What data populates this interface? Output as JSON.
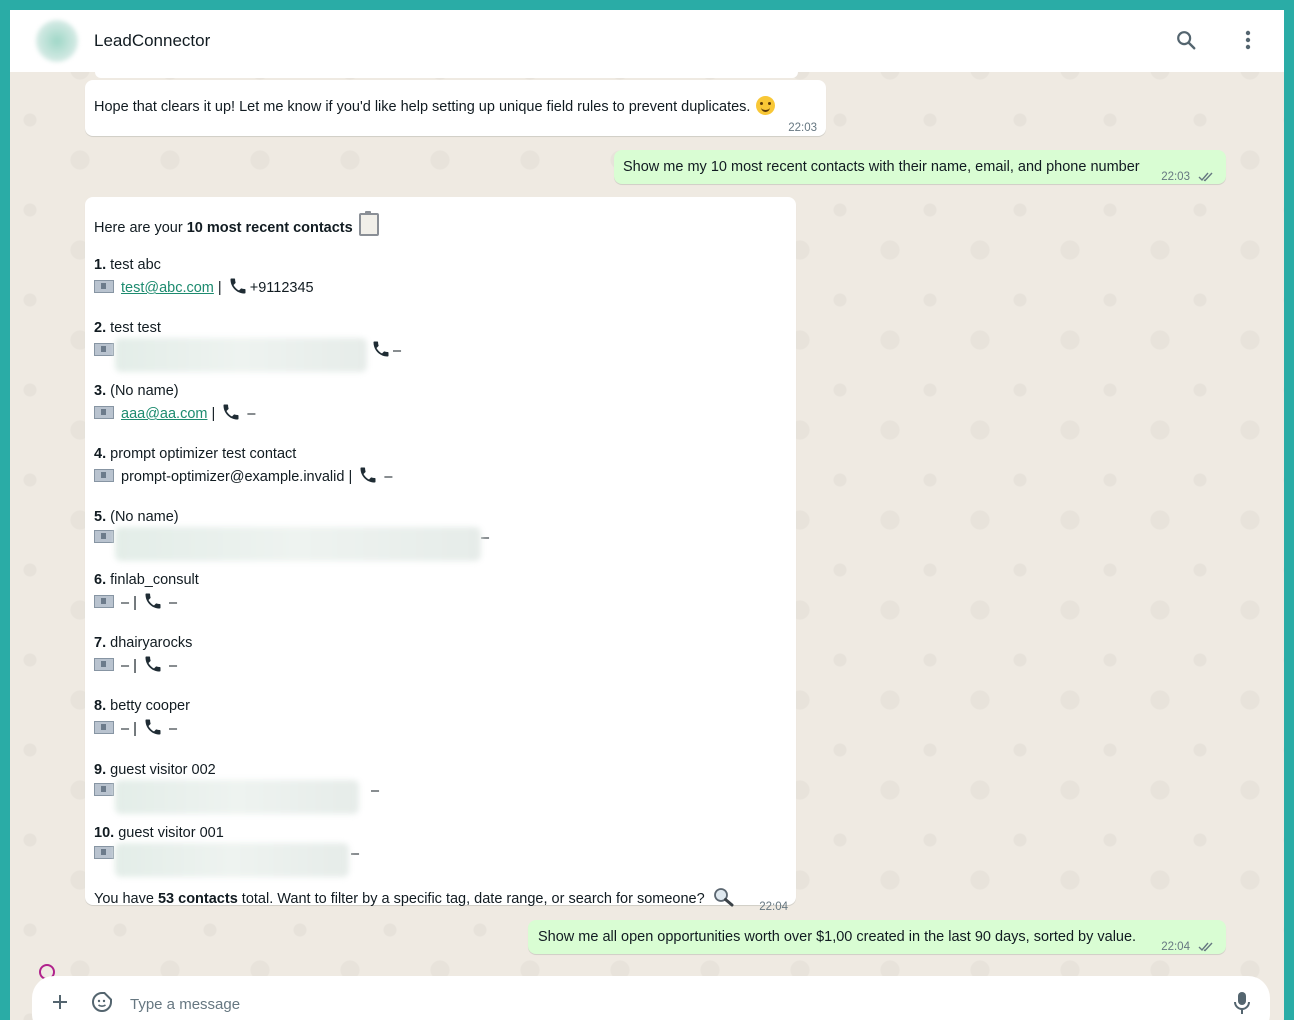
{
  "header": {
    "title": "LeadConnector",
    "icons": [
      "search-icon",
      "more-vert-icon"
    ]
  },
  "messages": {
    "m1": {
      "text": "Hope that clears it up! Let me know if you'd like help setting up unique field rules to prevent duplicates.",
      "emoji": "smiling-face-icon",
      "time": "22:03"
    },
    "m2": {
      "text": "Show me my 10 most recent contacts with their name, email, and phone number",
      "time": "22:03",
      "status": "read"
    },
    "m3": {
      "intro_prefix": "Here are your ",
      "intro_bold": "10 most recent contacts",
      "contacts": [
        {
          "num": "1.",
          "name": "test abc",
          "email": "test@abc.com",
          "phone": "+9112345"
        },
        {
          "num": "2.",
          "name": "test test",
          "phone": "–"
        },
        {
          "num": "3.",
          "name": "(No name)",
          "email": "aaa@aa.com",
          "phone": "–"
        },
        {
          "num": "4.",
          "name": "prompt optimizer test contact",
          "email": "prompt-optimizer@example.invalid",
          "phone": "–"
        },
        {
          "num": "5.",
          "name": "(No name)",
          "phone": "–"
        },
        {
          "num": "6.",
          "name": "finlab_consult",
          "email": "–",
          "phone": "–"
        },
        {
          "num": "7.",
          "name": "dhairyarocks",
          "email": "–",
          "phone": "–"
        },
        {
          "num": "8.",
          "name": "betty cooper",
          "email": "–",
          "phone": "–"
        },
        {
          "num": "9.",
          "name": "guest visitor 002",
          "phone": "–"
        },
        {
          "num": "10.",
          "name": "guest visitor 001",
          "phone": "–"
        }
      ],
      "separator": "|",
      "summary_prefix": "You have ",
      "summary_bold": "53 contacts",
      "summary_suffix": " total. Want to filter by a specific tag, date range, or search for someone?",
      "time": "22:04"
    },
    "m4": {
      "text": "Show me all open opportunities worth over $1,00 created in the last 90 days, sorted by value.",
      "time": "22:04",
      "status": "read"
    }
  },
  "composer": {
    "placeholder": "Type a message"
  },
  "colors": {
    "frame": "#2aaca6",
    "wallpaper": "#efeae2",
    "outgoing_bubble": "#d9fdd3",
    "incoming_bubble": "#ffffff",
    "link": "#1d8b6f"
  }
}
